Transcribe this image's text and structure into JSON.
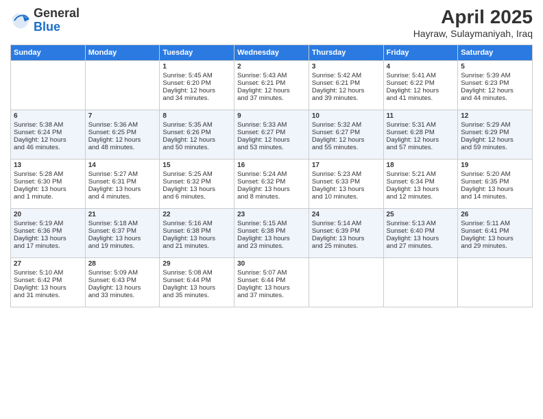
{
  "logo": {
    "general": "General",
    "blue": "Blue"
  },
  "title": "April 2025",
  "subtitle": "Hayraw, Sulaymaniyah, Iraq",
  "days_of_week": [
    "Sunday",
    "Monday",
    "Tuesday",
    "Wednesday",
    "Thursday",
    "Friday",
    "Saturday"
  ],
  "weeks": [
    [
      {
        "day": "",
        "lines": []
      },
      {
        "day": "",
        "lines": []
      },
      {
        "day": "1",
        "lines": [
          "Sunrise: 5:45 AM",
          "Sunset: 6:20 PM",
          "Daylight: 12 hours",
          "and 34 minutes."
        ]
      },
      {
        "day": "2",
        "lines": [
          "Sunrise: 5:43 AM",
          "Sunset: 6:21 PM",
          "Daylight: 12 hours",
          "and 37 minutes."
        ]
      },
      {
        "day": "3",
        "lines": [
          "Sunrise: 5:42 AM",
          "Sunset: 6:21 PM",
          "Daylight: 12 hours",
          "and 39 minutes."
        ]
      },
      {
        "day": "4",
        "lines": [
          "Sunrise: 5:41 AM",
          "Sunset: 6:22 PM",
          "Daylight: 12 hours",
          "and 41 minutes."
        ]
      },
      {
        "day": "5",
        "lines": [
          "Sunrise: 5:39 AM",
          "Sunset: 6:23 PM",
          "Daylight: 12 hours",
          "and 44 minutes."
        ]
      }
    ],
    [
      {
        "day": "6",
        "lines": [
          "Sunrise: 5:38 AM",
          "Sunset: 6:24 PM",
          "Daylight: 12 hours",
          "and 46 minutes."
        ]
      },
      {
        "day": "7",
        "lines": [
          "Sunrise: 5:36 AM",
          "Sunset: 6:25 PM",
          "Daylight: 12 hours",
          "and 48 minutes."
        ]
      },
      {
        "day": "8",
        "lines": [
          "Sunrise: 5:35 AM",
          "Sunset: 6:26 PM",
          "Daylight: 12 hours",
          "and 50 minutes."
        ]
      },
      {
        "day": "9",
        "lines": [
          "Sunrise: 5:33 AM",
          "Sunset: 6:27 PM",
          "Daylight: 12 hours",
          "and 53 minutes."
        ]
      },
      {
        "day": "10",
        "lines": [
          "Sunrise: 5:32 AM",
          "Sunset: 6:27 PM",
          "Daylight: 12 hours",
          "and 55 minutes."
        ]
      },
      {
        "day": "11",
        "lines": [
          "Sunrise: 5:31 AM",
          "Sunset: 6:28 PM",
          "Daylight: 12 hours",
          "and 57 minutes."
        ]
      },
      {
        "day": "12",
        "lines": [
          "Sunrise: 5:29 AM",
          "Sunset: 6:29 PM",
          "Daylight: 12 hours",
          "and 59 minutes."
        ]
      }
    ],
    [
      {
        "day": "13",
        "lines": [
          "Sunrise: 5:28 AM",
          "Sunset: 6:30 PM",
          "Daylight: 13 hours",
          "and 1 minute."
        ]
      },
      {
        "day": "14",
        "lines": [
          "Sunrise: 5:27 AM",
          "Sunset: 6:31 PM",
          "Daylight: 13 hours",
          "and 4 minutes."
        ]
      },
      {
        "day": "15",
        "lines": [
          "Sunrise: 5:25 AM",
          "Sunset: 6:32 PM",
          "Daylight: 13 hours",
          "and 6 minutes."
        ]
      },
      {
        "day": "16",
        "lines": [
          "Sunrise: 5:24 AM",
          "Sunset: 6:32 PM",
          "Daylight: 13 hours",
          "and 8 minutes."
        ]
      },
      {
        "day": "17",
        "lines": [
          "Sunrise: 5:23 AM",
          "Sunset: 6:33 PM",
          "Daylight: 13 hours",
          "and 10 minutes."
        ]
      },
      {
        "day": "18",
        "lines": [
          "Sunrise: 5:21 AM",
          "Sunset: 6:34 PM",
          "Daylight: 13 hours",
          "and 12 minutes."
        ]
      },
      {
        "day": "19",
        "lines": [
          "Sunrise: 5:20 AM",
          "Sunset: 6:35 PM",
          "Daylight: 13 hours",
          "and 14 minutes."
        ]
      }
    ],
    [
      {
        "day": "20",
        "lines": [
          "Sunrise: 5:19 AM",
          "Sunset: 6:36 PM",
          "Daylight: 13 hours",
          "and 17 minutes."
        ]
      },
      {
        "day": "21",
        "lines": [
          "Sunrise: 5:18 AM",
          "Sunset: 6:37 PM",
          "Daylight: 13 hours",
          "and 19 minutes."
        ]
      },
      {
        "day": "22",
        "lines": [
          "Sunrise: 5:16 AM",
          "Sunset: 6:38 PM",
          "Daylight: 13 hours",
          "and 21 minutes."
        ]
      },
      {
        "day": "23",
        "lines": [
          "Sunrise: 5:15 AM",
          "Sunset: 6:38 PM",
          "Daylight: 13 hours",
          "and 23 minutes."
        ]
      },
      {
        "day": "24",
        "lines": [
          "Sunrise: 5:14 AM",
          "Sunset: 6:39 PM",
          "Daylight: 13 hours",
          "and 25 minutes."
        ]
      },
      {
        "day": "25",
        "lines": [
          "Sunrise: 5:13 AM",
          "Sunset: 6:40 PM",
          "Daylight: 13 hours",
          "and 27 minutes."
        ]
      },
      {
        "day": "26",
        "lines": [
          "Sunrise: 5:11 AM",
          "Sunset: 6:41 PM",
          "Daylight: 13 hours",
          "and 29 minutes."
        ]
      }
    ],
    [
      {
        "day": "27",
        "lines": [
          "Sunrise: 5:10 AM",
          "Sunset: 6:42 PM",
          "Daylight: 13 hours",
          "and 31 minutes."
        ]
      },
      {
        "day": "28",
        "lines": [
          "Sunrise: 5:09 AM",
          "Sunset: 6:43 PM",
          "Daylight: 13 hours",
          "and 33 minutes."
        ]
      },
      {
        "day": "29",
        "lines": [
          "Sunrise: 5:08 AM",
          "Sunset: 6:44 PM",
          "Daylight: 13 hours",
          "and 35 minutes."
        ]
      },
      {
        "day": "30",
        "lines": [
          "Sunrise: 5:07 AM",
          "Sunset: 6:44 PM",
          "Daylight: 13 hours",
          "and 37 minutes."
        ]
      },
      {
        "day": "",
        "lines": []
      },
      {
        "day": "",
        "lines": []
      },
      {
        "day": "",
        "lines": []
      }
    ]
  ]
}
